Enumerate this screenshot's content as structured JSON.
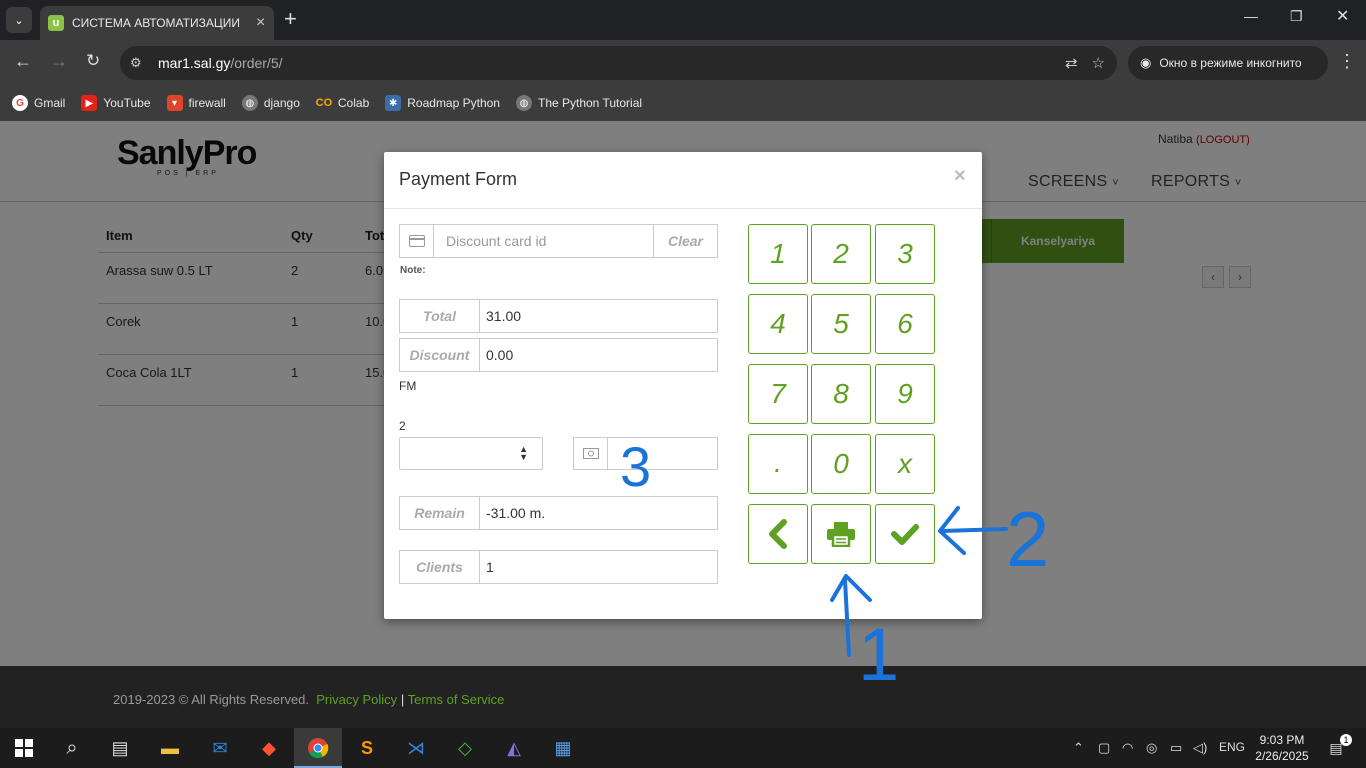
{
  "browser": {
    "tab_title": "СИСТЕМА АВТОМАТИЗАЦИИ",
    "tab_favicon": "u",
    "url_host": "mar1.sal.gy",
    "url_path": "/order/5/",
    "incognito_label": "Окно в режиме инкогнито",
    "bookmarks": [
      "Gmail",
      "YouTube",
      "firewall",
      "django",
      "Colab",
      "Roadmap Python",
      "The Python Tutorial"
    ]
  },
  "site": {
    "logo": "SanlyPro",
    "logo_sub": "POS | ERP",
    "user": "Natiba",
    "logout": "(LOGOUT)",
    "nav": [
      "SCREENS",
      "REPORTS"
    ],
    "nav_caret": "˅",
    "category_buttons": [
      "Kanselyariya"
    ],
    "order_table": {
      "headers": [
        "Item",
        "Qty",
        "Tot"
      ],
      "rows": [
        [
          "Arassa suw 0.5 LT",
          "2",
          "6.0"
        ],
        [
          "Corek",
          "1",
          "10.0"
        ],
        [
          "Coca Cola 1LT",
          "1",
          "15.0"
        ]
      ]
    }
  },
  "modal": {
    "title": "Payment Form",
    "close": "×",
    "discount_card_placeholder": "Discount card id",
    "clear_label": "Clear",
    "note_label": "Note:",
    "total_label": "Total",
    "total_value": "31.00",
    "discount_label": "Discount",
    "discount_value": "0.00",
    "currency_label": "FM",
    "payment_count": "2",
    "remain_label": "Remain",
    "remain_value": "-31.00 m.",
    "clients_label": "Clients",
    "clients_value": "1",
    "keypad": [
      "1",
      "2",
      "3",
      "4",
      "5",
      "6",
      "7",
      "8",
      "9",
      ".",
      "0",
      "x"
    ]
  },
  "footer": {
    "copyright": "2019-2023 © All Rights Reserved.",
    "privacy": "Privacy Policy",
    "separator": "|",
    "terms": "Terms of Service"
  },
  "annotations": [
    "1",
    "2",
    "3"
  ],
  "taskbar": {
    "language": "ENG",
    "time": "9:03 PM",
    "date": "2/26/2025",
    "notifications": "1"
  },
  "colors": {
    "accent": "#5fa122",
    "annotation": "#1a73d9"
  }
}
